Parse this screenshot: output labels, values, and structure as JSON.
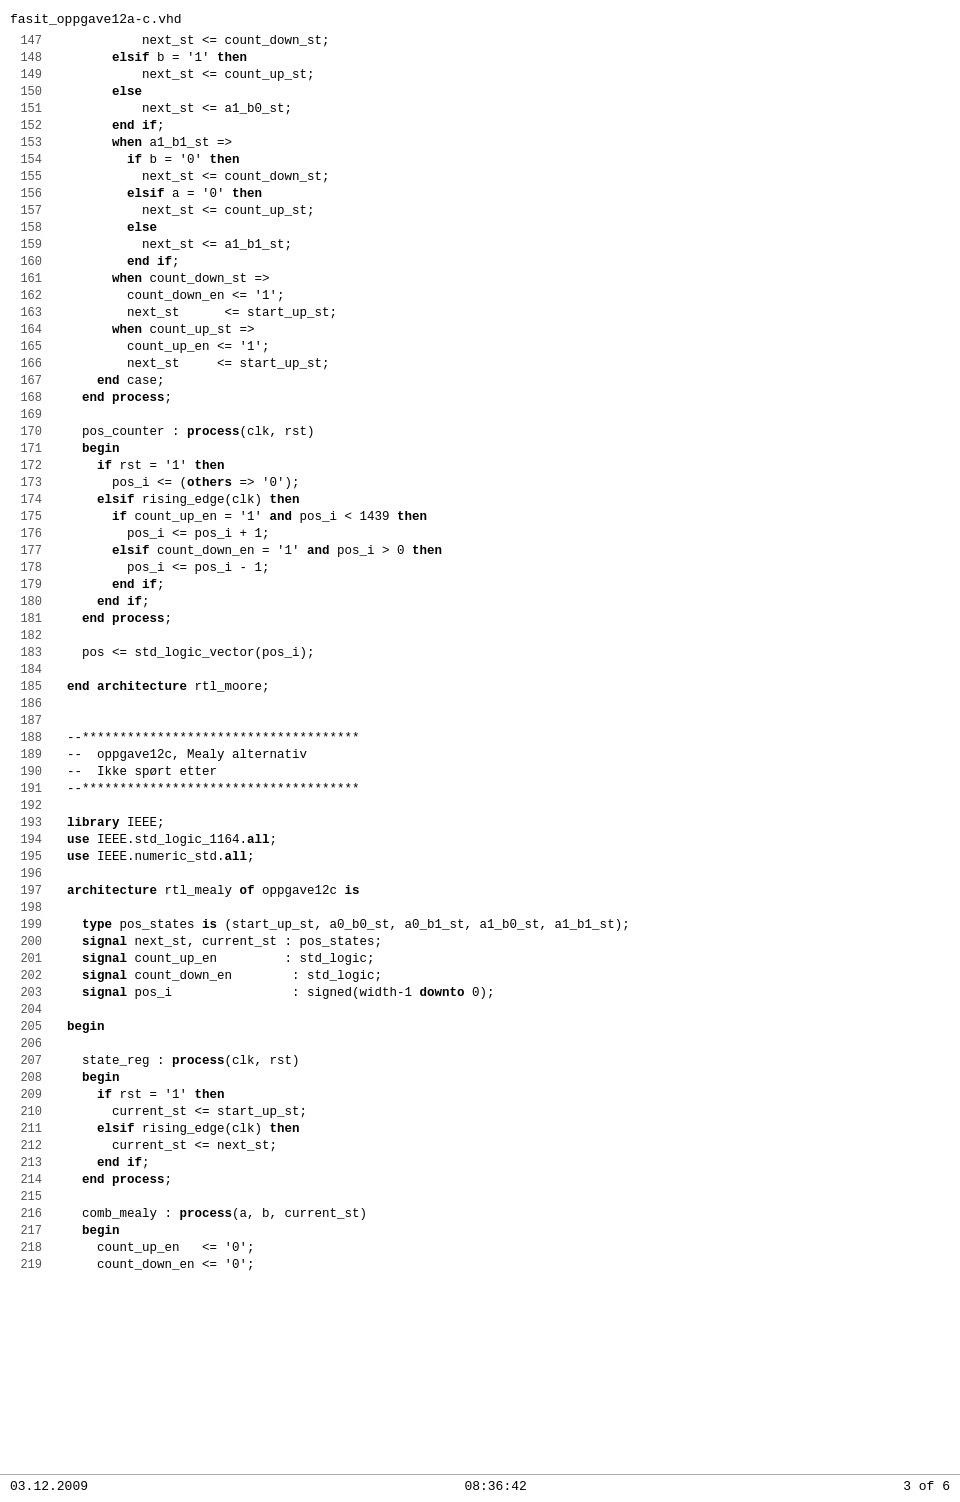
{
  "title": "fasit_oppgave12a-c.vhd",
  "footer": {
    "date": "03.12.2009",
    "time": "08:36:42",
    "page": "3 of 6"
  },
  "lines": [
    {
      "num": "147",
      "text": "            next_st <= count_down_st;"
    },
    {
      "num": "148",
      "text": "        elsif b = '1' then"
    },
    {
      "num": "149",
      "text": "            next_st <= count_up_st;"
    },
    {
      "num": "150",
      "text": "        else"
    },
    {
      "num": "151",
      "text": "            next_st <= a1_b0_st;"
    },
    {
      "num": "152",
      "text": "        end if;"
    },
    {
      "num": "153",
      "text": "        when a1_b1_st =>"
    },
    {
      "num": "154",
      "text": "          if b = '0' then"
    },
    {
      "num": "155",
      "text": "            next_st <= count_down_st;"
    },
    {
      "num": "156",
      "text": "          elsif a = '0' then"
    },
    {
      "num": "157",
      "text": "            next_st <= count_up_st;"
    },
    {
      "num": "158",
      "text": "          else"
    },
    {
      "num": "159",
      "text": "            next_st <= a1_b1_st;"
    },
    {
      "num": "160",
      "text": "          end if;"
    },
    {
      "num": "161",
      "text": "        when count_down_st =>"
    },
    {
      "num": "162",
      "text": "          count_down_en <= '1';"
    },
    {
      "num": "163",
      "text": "          next_st      <= start_up_st;"
    },
    {
      "num": "164",
      "text": "        when count_up_st =>"
    },
    {
      "num": "165",
      "text": "          count_up_en <= '1';"
    },
    {
      "num": "166",
      "text": "          next_st     <= start_up_st;"
    },
    {
      "num": "167",
      "text": "      end case;"
    },
    {
      "num": "168",
      "text": "    end process;"
    },
    {
      "num": "169",
      "text": ""
    },
    {
      "num": "170",
      "text": "    pos_counter : process(clk, rst)"
    },
    {
      "num": "171",
      "text": "    begin"
    },
    {
      "num": "172",
      "text": "      if rst = '1' then"
    },
    {
      "num": "173",
      "text": "        pos_i <= (others => '0');"
    },
    {
      "num": "174",
      "text": "      elsif rising_edge(clk) then"
    },
    {
      "num": "175",
      "text": "        if count_up_en = '1' and pos_i < 1439 then"
    },
    {
      "num": "176",
      "text": "          pos_i <= pos_i + 1;"
    },
    {
      "num": "177",
      "text": "        elsif count_down_en = '1' and pos_i > 0 then"
    },
    {
      "num": "178",
      "text": "          pos_i <= pos_i - 1;"
    },
    {
      "num": "179",
      "text": "        end if;"
    },
    {
      "num": "180",
      "text": "      end if;"
    },
    {
      "num": "181",
      "text": "    end process;"
    },
    {
      "num": "182",
      "text": ""
    },
    {
      "num": "183",
      "text": "    pos <= std_logic_vector(pos_i);"
    },
    {
      "num": "184",
      "text": ""
    },
    {
      "num": "185",
      "text": "  end architecture rtl_moore;"
    },
    {
      "num": "186",
      "text": ""
    },
    {
      "num": "187",
      "text": ""
    },
    {
      "num": "188",
      "text": "  --*************************************"
    },
    {
      "num": "189",
      "text": "  --  oppgave12c, Mealy alternativ"
    },
    {
      "num": "190",
      "text": "  --  Ikke spørt etter"
    },
    {
      "num": "191",
      "text": "  --*************************************"
    },
    {
      "num": "192",
      "text": ""
    },
    {
      "num": "193",
      "text": "  library IEEE;"
    },
    {
      "num": "194",
      "text": "  use IEEE.std_logic_1164.all;"
    },
    {
      "num": "195",
      "text": "  use IEEE.numeric_std.all;"
    },
    {
      "num": "196",
      "text": ""
    },
    {
      "num": "197",
      "text": "  architecture rtl_mealy of oppgave12c is"
    },
    {
      "num": "198",
      "text": ""
    },
    {
      "num": "199",
      "text": "    type pos_states is (start_up_st, a0_b0_st, a0_b1_st, a1_b0_st, a1_b1_st);"
    },
    {
      "num": "200",
      "text": "    signal next_st, current_st : pos_states;"
    },
    {
      "num": "201",
      "text": "    signal count_up_en         : std_logic;"
    },
    {
      "num": "202",
      "text": "    signal count_down_en        : std_logic;"
    },
    {
      "num": "203",
      "text": "    signal pos_i                : signed(width-1 downto 0);"
    },
    {
      "num": "204",
      "text": ""
    },
    {
      "num": "205",
      "text": "  begin"
    },
    {
      "num": "206",
      "text": ""
    },
    {
      "num": "207",
      "text": "    state_reg : process(clk, rst)"
    },
    {
      "num": "208",
      "text": "    begin"
    },
    {
      "num": "209",
      "text": "      if rst = '1' then"
    },
    {
      "num": "210",
      "text": "        current_st <= start_up_st;"
    },
    {
      "num": "211",
      "text": "      elsif rising_edge(clk) then"
    },
    {
      "num": "212",
      "text": "        current_st <= next_st;"
    },
    {
      "num": "213",
      "text": "      end if;"
    },
    {
      "num": "214",
      "text": "    end process;"
    },
    {
      "num": "215",
      "text": ""
    },
    {
      "num": "216",
      "text": "    comb_mealy : process(a, b, current_st)"
    },
    {
      "num": "217",
      "text": "    begin"
    },
    {
      "num": "218",
      "text": "      count_up_en   <= '0';"
    },
    {
      "num": "219",
      "text": "      count_down_en <= '0';"
    }
  ]
}
